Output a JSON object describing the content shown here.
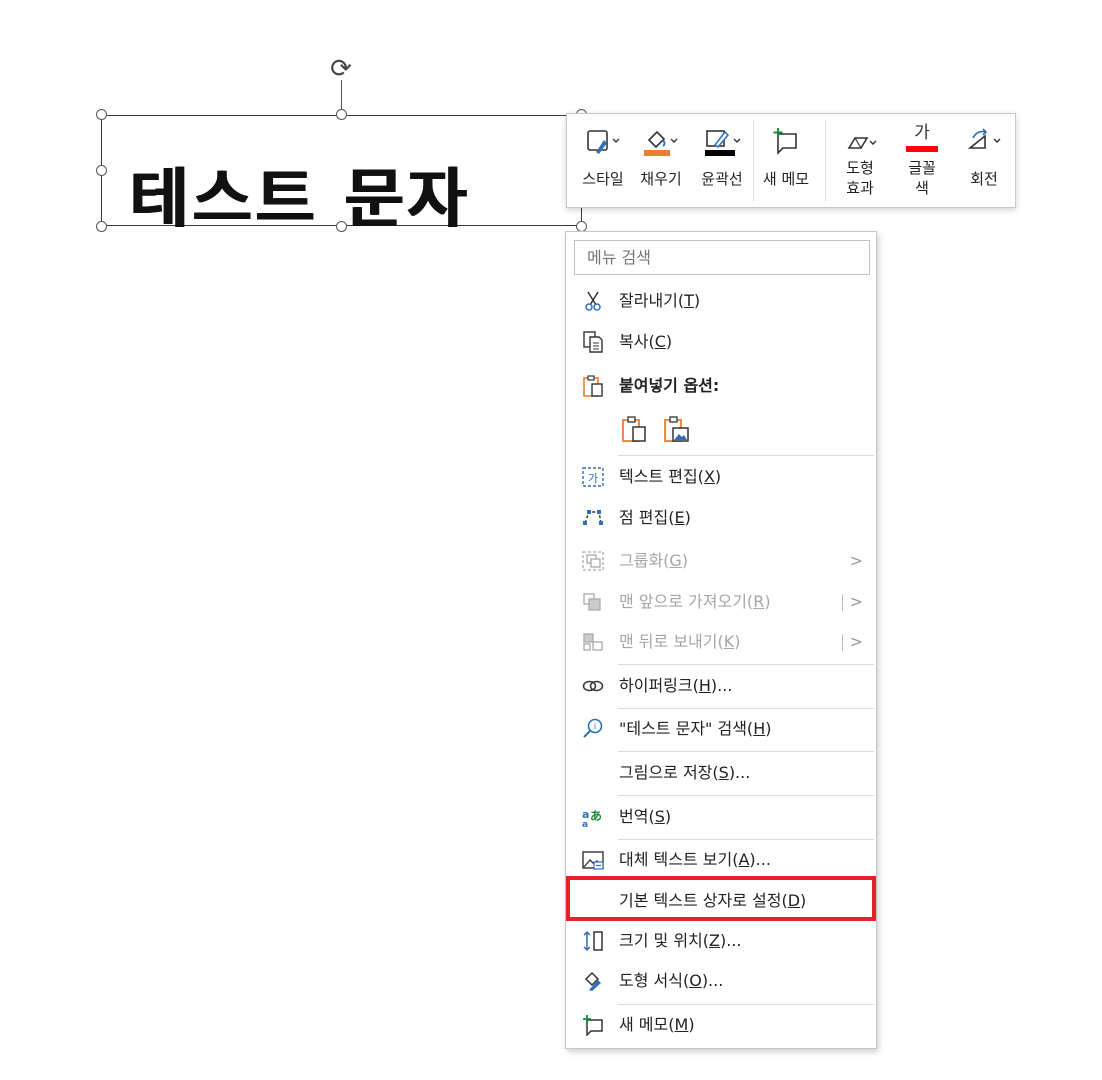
{
  "slide": {
    "textbox_text": "테스트 문자"
  },
  "mini_toolbar": {
    "tools": [
      {
        "label": "스타일",
        "icon": "shape-style-icon"
      },
      {
        "label": "채우기",
        "icon": "fill-bucket-icon",
        "color": "#ED7D31"
      },
      {
        "label": "윤곽선",
        "icon": "outline-pen-icon",
        "color": "#000000"
      },
      {
        "label": "새 메모",
        "icon": "new-comment-icon"
      },
      {
        "label": "도형\n효과",
        "icon": "shape-effects-icon"
      },
      {
        "label": "글꼴\n색",
        "icon": "font-color-icon",
        "glyph": "가",
        "color": "#FF0000"
      },
      {
        "label": "회전",
        "icon": "rotate-icon"
      }
    ]
  },
  "context_menu": {
    "search_placeholder": "메뉴 검색",
    "items": {
      "cut": {
        "text": "잘라내기(",
        "key": "T",
        "tail": ")"
      },
      "copy": {
        "text": "복사(",
        "key": "C",
        "tail": ")"
      },
      "paste_options": {
        "text": "붙여넣기 옵션:"
      },
      "edit_text": {
        "text": "텍스트 편집(",
        "key": "X",
        "tail": ")"
      },
      "edit_points": {
        "text": "점 편집(",
        "key": "E",
        "tail": ")"
      },
      "group": {
        "text": "그룹화(",
        "key": "G",
        "tail": ")"
      },
      "bring_front": {
        "text": "맨 앞으로 가져오기(",
        "key": "R",
        "tail": ")"
      },
      "send_back": {
        "text": "맨 뒤로 보내기(",
        "key": "K",
        "tail": ")"
      },
      "hyperlink": {
        "text": "하이퍼링크(",
        "key": "H",
        "tail": ")..."
      },
      "search_text": {
        "text": "\"테스트 문자\" 검색(",
        "key": "H",
        "tail": ")"
      },
      "save_picture": {
        "text": "그림으로 저장(",
        "key": "S",
        "tail": ")..."
      },
      "translate": {
        "text": "번역(",
        "key": "S",
        "tail": ")"
      },
      "alt_text": {
        "text": "대체 텍스트 보기(",
        "key": "A",
        "tail": ")..."
      },
      "default_textbox": {
        "text": "기본 텍스트 상자로 설정(",
        "key": "D",
        "tail": ")"
      },
      "size_position": {
        "text": "크기 및 위치(",
        "key": "Z",
        "tail": ")..."
      },
      "format_shape": {
        "text": "도형 서식(",
        "key": "O",
        "tail": ")..."
      },
      "new_comment": {
        "text": "새 메모(",
        "key": "M",
        "tail": ")"
      }
    },
    "submenu_arrow": ">",
    "highlight_color": "#E8202A"
  }
}
